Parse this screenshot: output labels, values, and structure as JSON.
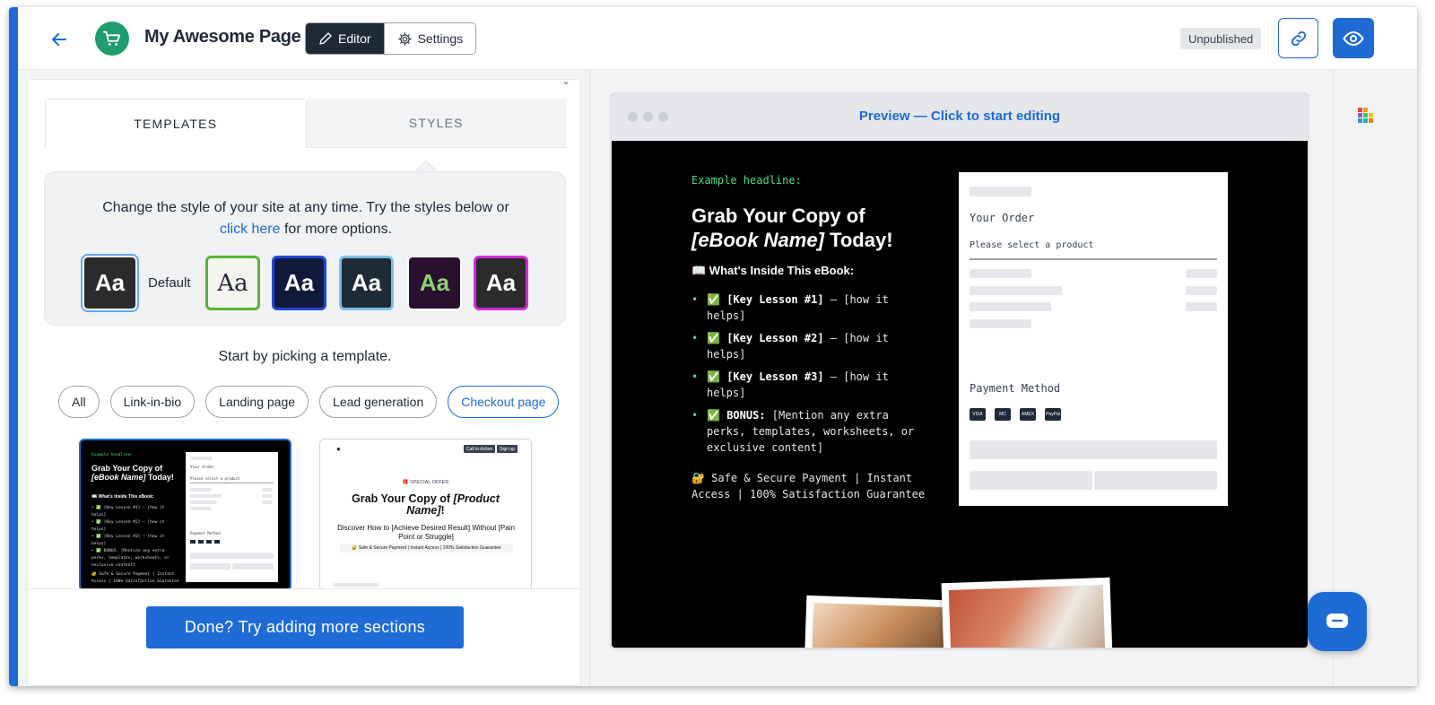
{
  "header": {
    "page_title": "My Awesome Page",
    "editor_label": "Editor",
    "settings_label": "Settings",
    "status": "Unpublished"
  },
  "panel": {
    "tabs": [
      {
        "label": "TEMPLATES",
        "active": true
      },
      {
        "label": "STYLES",
        "active": false
      }
    ],
    "style_desc_pre": "Change the style of your site at any time. Try the styles below or",
    "style_desc_link": "click here",
    "style_desc_post": "for more options.",
    "swatch_glyph": "Aa",
    "default_label": "Default",
    "start_text": "Start by picking a template.",
    "filters": [
      {
        "label": "All",
        "active": false
      },
      {
        "label": "Link-in-bio",
        "active": false
      },
      {
        "label": "Landing page",
        "active": false
      },
      {
        "label": "Lead generation",
        "active": false
      },
      {
        "label": "Checkout page",
        "active": true
      }
    ],
    "done_button": "Done? Try adding more sections"
  },
  "template_light": {
    "badge": "SPECIAL OFFER",
    "cta1": "Call to Action",
    "cta2": "Sign up",
    "title_pre": "Grab Your Copy of",
    "title_em": "[Product Name]",
    "title_post": "!",
    "subtitle": "Discover How to [Achieve Desired Result] Without [Pain Point or Struggle]",
    "guarantee": "Safe & Secure Payment | Instant Access | 100% Satisfaction Guarantee"
  },
  "preview": {
    "label": "Preview — Click to start editing",
    "eyebrow": "Example headline:",
    "headline_pre": "Grab Your Copy of",
    "headline_em": "[eBook Name]",
    "headline_post": "Today!",
    "subhead": "📖 What's Inside This eBook:",
    "items": [
      {
        "bold": "[Key Lesson #1]",
        "text": " – [how it helps]"
      },
      {
        "bold": "[Key Lesson #2]",
        "text": " – [how it helps]"
      },
      {
        "bold": "[Key Lesson #3]",
        "text": " – [how it helps]"
      },
      {
        "bold": "BONUS:",
        "text": " [Mention any extra perks, templates, worksheets, or exclusive content]"
      }
    ],
    "check": "✅",
    "secure": "🔐 Safe & Secure Payment | Instant Access | 100% Satisfaction Guarantee",
    "order_title": "Your Order",
    "order_select": "Please select a product",
    "payment_title": "Payment Method",
    "payment_icons": [
      "VISA",
      "MC",
      "AMEX",
      "PayPal"
    ]
  },
  "colors": {
    "accent": "#1e6bd6",
    "brand_green": "#1f9d6a",
    "preview_green": "#4ade80"
  }
}
